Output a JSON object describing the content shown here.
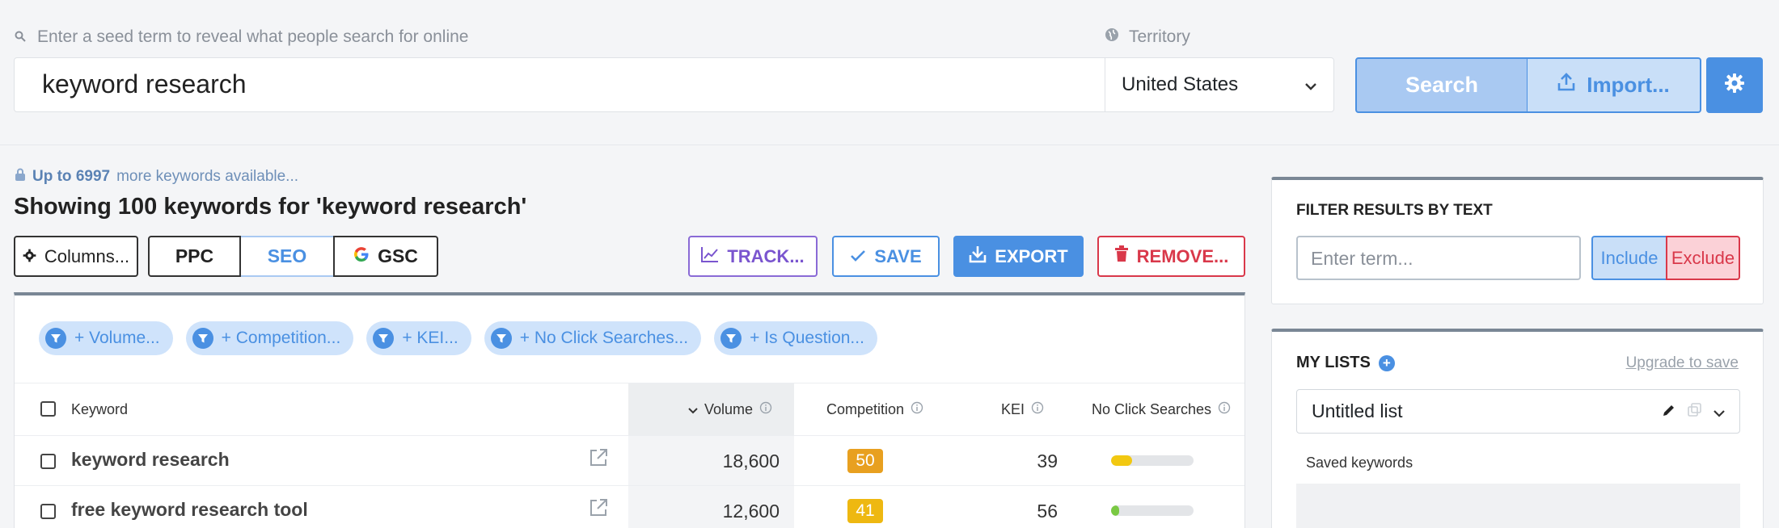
{
  "search": {
    "hint": "Enter a seed term to reveal what people search for online",
    "value": "keyword research",
    "territory_label": "Territory",
    "territory_value": "United States",
    "search_label": "Search",
    "import_label": "Import..."
  },
  "info": {
    "more_prefix": "Up to 6997",
    "more_suffix": "more keywords available...",
    "title": "Showing 100 keywords for 'keyword research'"
  },
  "toolbar": {
    "columns": "Columns...",
    "ppc": "PPC",
    "seo": "SEO",
    "gsc": "GSC",
    "track": "TRACK...",
    "save": "SAVE",
    "export": "EXPORT",
    "remove": "REMOVE..."
  },
  "filters": [
    "+ Volume...",
    "+ Competition...",
    "+ KEI...",
    "+ No Click Searches...",
    "+ Is Question..."
  ],
  "table": {
    "headers": {
      "keyword": "Keyword",
      "volume": "Volume",
      "competition": "Competition",
      "kei": "KEI",
      "no_click": "No Click Searches"
    },
    "rows": [
      {
        "keyword": "keyword research",
        "volume": "18,600",
        "competition": "50",
        "competition_color": "#e8a020",
        "kei": "39",
        "no_click_fraction": 0.25,
        "no_click_color": "#f2c811"
      },
      {
        "keyword": "free keyword research tool",
        "volume": "12,600",
        "competition": "41",
        "competition_color": "#eeb811",
        "kei": "56",
        "no_click_fraction": 0.1,
        "no_click_color": "#7ac943"
      }
    ]
  },
  "filter_panel": {
    "title": "FILTER RESULTS BY TEXT",
    "placeholder": "Enter term...",
    "include": "Include",
    "exclude": "Exclude"
  },
  "lists_panel": {
    "title": "MY LISTS",
    "upgrade": "Upgrade to save",
    "list_name": "Untitled list",
    "saved_label": "Saved keywords"
  },
  "colors": {
    "accent": "#4a90e2",
    "danger": "#d9384a",
    "track": "#7a55cf"
  }
}
